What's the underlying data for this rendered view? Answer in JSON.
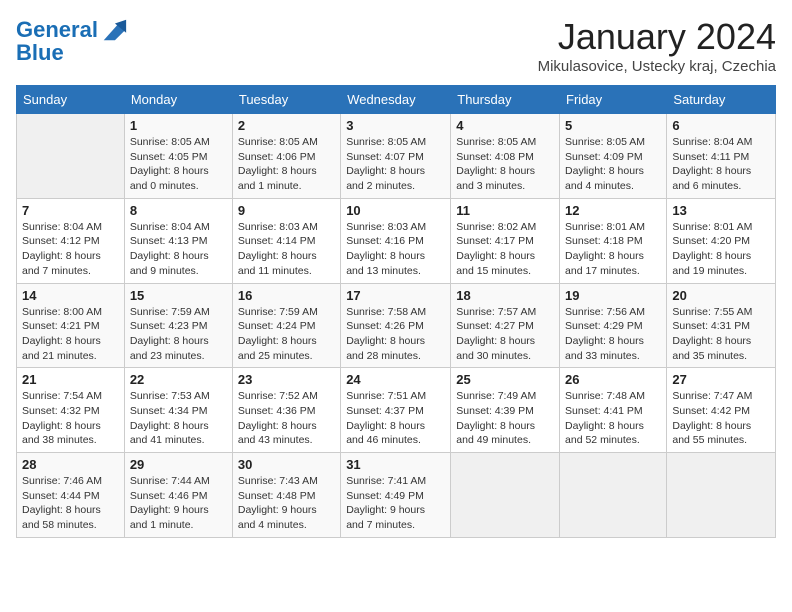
{
  "header": {
    "logo_general": "General",
    "logo_blue": "Blue",
    "month_title": "January 2024",
    "location": "Mikulasovice, Ustecky kraj, Czechia"
  },
  "days_of_week": [
    "Sunday",
    "Monday",
    "Tuesday",
    "Wednesday",
    "Thursday",
    "Friday",
    "Saturday"
  ],
  "weeks": [
    [
      {
        "day": "",
        "sunrise": "",
        "sunset": "",
        "daylight": ""
      },
      {
        "day": "1",
        "sunrise": "Sunrise: 8:05 AM",
        "sunset": "Sunset: 4:05 PM",
        "daylight": "Daylight: 8 hours and 0 minutes."
      },
      {
        "day": "2",
        "sunrise": "Sunrise: 8:05 AM",
        "sunset": "Sunset: 4:06 PM",
        "daylight": "Daylight: 8 hours and 1 minute."
      },
      {
        "day": "3",
        "sunrise": "Sunrise: 8:05 AM",
        "sunset": "Sunset: 4:07 PM",
        "daylight": "Daylight: 8 hours and 2 minutes."
      },
      {
        "day": "4",
        "sunrise": "Sunrise: 8:05 AM",
        "sunset": "Sunset: 4:08 PM",
        "daylight": "Daylight: 8 hours and 3 minutes."
      },
      {
        "day": "5",
        "sunrise": "Sunrise: 8:05 AM",
        "sunset": "Sunset: 4:09 PM",
        "daylight": "Daylight: 8 hours and 4 minutes."
      },
      {
        "day": "6",
        "sunrise": "Sunrise: 8:04 AM",
        "sunset": "Sunset: 4:11 PM",
        "daylight": "Daylight: 8 hours and 6 minutes."
      }
    ],
    [
      {
        "day": "7",
        "sunrise": "Sunrise: 8:04 AM",
        "sunset": "Sunset: 4:12 PM",
        "daylight": "Daylight: 8 hours and 7 minutes."
      },
      {
        "day": "8",
        "sunrise": "Sunrise: 8:04 AM",
        "sunset": "Sunset: 4:13 PM",
        "daylight": "Daylight: 8 hours and 9 minutes."
      },
      {
        "day": "9",
        "sunrise": "Sunrise: 8:03 AM",
        "sunset": "Sunset: 4:14 PM",
        "daylight": "Daylight: 8 hours and 11 minutes."
      },
      {
        "day": "10",
        "sunrise": "Sunrise: 8:03 AM",
        "sunset": "Sunset: 4:16 PM",
        "daylight": "Daylight: 8 hours and 13 minutes."
      },
      {
        "day": "11",
        "sunrise": "Sunrise: 8:02 AM",
        "sunset": "Sunset: 4:17 PM",
        "daylight": "Daylight: 8 hours and 15 minutes."
      },
      {
        "day": "12",
        "sunrise": "Sunrise: 8:01 AM",
        "sunset": "Sunset: 4:18 PM",
        "daylight": "Daylight: 8 hours and 17 minutes."
      },
      {
        "day": "13",
        "sunrise": "Sunrise: 8:01 AM",
        "sunset": "Sunset: 4:20 PM",
        "daylight": "Daylight: 8 hours and 19 minutes."
      }
    ],
    [
      {
        "day": "14",
        "sunrise": "Sunrise: 8:00 AM",
        "sunset": "Sunset: 4:21 PM",
        "daylight": "Daylight: 8 hours and 21 minutes."
      },
      {
        "day": "15",
        "sunrise": "Sunrise: 7:59 AM",
        "sunset": "Sunset: 4:23 PM",
        "daylight": "Daylight: 8 hours and 23 minutes."
      },
      {
        "day": "16",
        "sunrise": "Sunrise: 7:59 AM",
        "sunset": "Sunset: 4:24 PM",
        "daylight": "Daylight: 8 hours and 25 minutes."
      },
      {
        "day": "17",
        "sunrise": "Sunrise: 7:58 AM",
        "sunset": "Sunset: 4:26 PM",
        "daylight": "Daylight: 8 hours and 28 minutes."
      },
      {
        "day": "18",
        "sunrise": "Sunrise: 7:57 AM",
        "sunset": "Sunset: 4:27 PM",
        "daylight": "Daylight: 8 hours and 30 minutes."
      },
      {
        "day": "19",
        "sunrise": "Sunrise: 7:56 AM",
        "sunset": "Sunset: 4:29 PM",
        "daylight": "Daylight: 8 hours and 33 minutes."
      },
      {
        "day": "20",
        "sunrise": "Sunrise: 7:55 AM",
        "sunset": "Sunset: 4:31 PM",
        "daylight": "Daylight: 8 hours and 35 minutes."
      }
    ],
    [
      {
        "day": "21",
        "sunrise": "Sunrise: 7:54 AM",
        "sunset": "Sunset: 4:32 PM",
        "daylight": "Daylight: 8 hours and 38 minutes."
      },
      {
        "day": "22",
        "sunrise": "Sunrise: 7:53 AM",
        "sunset": "Sunset: 4:34 PM",
        "daylight": "Daylight: 8 hours and 41 minutes."
      },
      {
        "day": "23",
        "sunrise": "Sunrise: 7:52 AM",
        "sunset": "Sunset: 4:36 PM",
        "daylight": "Daylight: 8 hours and 43 minutes."
      },
      {
        "day": "24",
        "sunrise": "Sunrise: 7:51 AM",
        "sunset": "Sunset: 4:37 PM",
        "daylight": "Daylight: 8 hours and 46 minutes."
      },
      {
        "day": "25",
        "sunrise": "Sunrise: 7:49 AM",
        "sunset": "Sunset: 4:39 PM",
        "daylight": "Daylight: 8 hours and 49 minutes."
      },
      {
        "day": "26",
        "sunrise": "Sunrise: 7:48 AM",
        "sunset": "Sunset: 4:41 PM",
        "daylight": "Daylight: 8 hours and 52 minutes."
      },
      {
        "day": "27",
        "sunrise": "Sunrise: 7:47 AM",
        "sunset": "Sunset: 4:42 PM",
        "daylight": "Daylight: 8 hours and 55 minutes."
      }
    ],
    [
      {
        "day": "28",
        "sunrise": "Sunrise: 7:46 AM",
        "sunset": "Sunset: 4:44 PM",
        "daylight": "Daylight: 8 hours and 58 minutes."
      },
      {
        "day": "29",
        "sunrise": "Sunrise: 7:44 AM",
        "sunset": "Sunset: 4:46 PM",
        "daylight": "Daylight: 9 hours and 1 minute."
      },
      {
        "day": "30",
        "sunrise": "Sunrise: 7:43 AM",
        "sunset": "Sunset: 4:48 PM",
        "daylight": "Daylight: 9 hours and 4 minutes."
      },
      {
        "day": "31",
        "sunrise": "Sunrise: 7:41 AM",
        "sunset": "Sunset: 4:49 PM",
        "daylight": "Daylight: 9 hours and 7 minutes."
      },
      {
        "day": "",
        "sunrise": "",
        "sunset": "",
        "daylight": ""
      },
      {
        "day": "",
        "sunrise": "",
        "sunset": "",
        "daylight": ""
      },
      {
        "day": "",
        "sunrise": "",
        "sunset": "",
        "daylight": ""
      }
    ]
  ]
}
